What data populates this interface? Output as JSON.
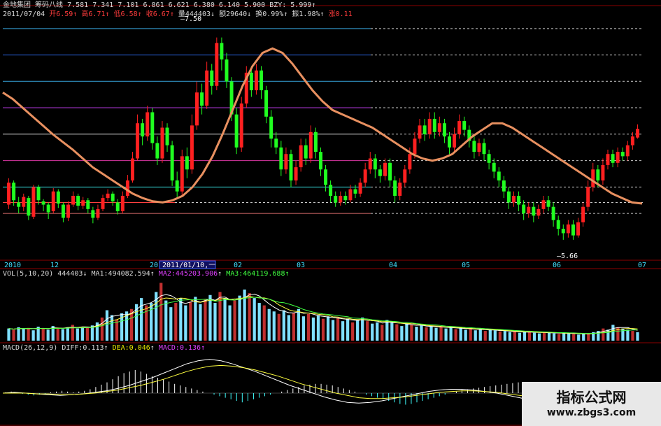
{
  "header": {
    "stock_name": "金地集团",
    "indicator_name": "筹码八线",
    "levels": [
      "7.581",
      "7.341",
      "7.101",
      "6.861",
      "6.621",
      "6.380",
      "6.140",
      "5.900"
    ],
    "bzy": "BZY: 5.999",
    "date": "2011/07/04",
    "open": "开6.59",
    "high": "高6.71",
    "low": "低6.58",
    "close": "收6.67",
    "volume": "量444403",
    "amount": "额29640",
    "turnover": "换0.99%",
    "amplitude": "振1.98%",
    "change": "涨0.11"
  },
  "price_annotations": {
    "high_label": "7.50",
    "low_label": "5.66",
    "cursor_date": "2011/01/10,一"
  },
  "x_axis": {
    "labels": [
      "2010",
      "12",
      "2011",
      "02",
      "03",
      "04",
      "05",
      "06",
      "07"
    ]
  },
  "volume_header": {
    "name": "VOL(5,10,20)",
    "value": "444403",
    "ma1": "MA1:494082.594",
    "ma2": "MA2:445203.906",
    "ma3": "MA3:464119.688"
  },
  "macd_header": {
    "name": "MACD(26,12,9)",
    "diff": "DIFF:0.113",
    "dea": "DEA:0.046",
    "macd": "MACD:0.136"
  },
  "watermark": {
    "line1": "指标公式网",
    "line2": "www.zbgs3.com"
  },
  "chart_data": {
    "type": "candlestick",
    "title": "",
    "price_range": [
      5.5,
      7.65
    ],
    "chip_lines": [
      7.581,
      7.341,
      7.101,
      6.861,
      6.621,
      6.38,
      6.14,
      5.9
    ],
    "bzy": 5.999,
    "candles": [
      [
        5.98,
        6.18,
        6.22,
        5.94
      ],
      [
        6.18,
        6.02,
        6.2,
        5.97
      ],
      [
        6.0,
        5.96,
        6.05,
        5.9
      ],
      [
        5.96,
        6.05,
        6.08,
        5.92
      ],
      [
        6.04,
        5.88,
        6.06,
        5.84
      ],
      [
        5.87,
        6.14,
        6.16,
        5.85
      ],
      [
        6.14,
        6.02,
        6.16,
        5.98
      ],
      [
        6.01,
        5.98,
        6.03,
        5.92
      ],
      [
        5.98,
        5.91,
        6.0,
        5.85
      ],
      [
        5.92,
        6.1,
        6.13,
        5.9
      ],
      [
        6.1,
        5.99,
        6.12,
        5.95
      ],
      [
        5.98,
        5.86,
        6.0,
        5.82
      ],
      [
        5.86,
        5.98,
        6.01,
        5.83
      ],
      [
        5.98,
        6.06,
        6.1,
        5.96
      ],
      [
        6.06,
        5.97,
        6.08,
        5.93
      ],
      [
        5.97,
        6.02,
        6.05,
        5.94
      ],
      [
        6.02,
        5.94,
        6.04,
        5.9
      ],
      [
        5.93,
        5.86,
        5.96,
        5.81
      ],
      [
        5.86,
        5.94,
        5.98,
        5.84
      ],
      [
        5.94,
        6.04,
        6.07,
        5.92
      ],
      [
        6.04,
        6.08,
        6.12,
        6.01
      ],
      [
        6.08,
        6.01,
        6.1,
        5.97
      ],
      [
        6.0,
        5.92,
        6.03,
        5.89
      ],
      [
        5.92,
        6.06,
        6.1,
        5.9
      ],
      [
        6.06,
        6.2,
        6.25,
        6.04
      ],
      [
        6.2,
        6.4,
        6.46,
        6.18
      ],
      [
        6.4,
        6.72,
        6.8,
        6.38
      ],
      [
        6.72,
        6.6,
        6.76,
        6.52
      ],
      [
        6.6,
        6.82,
        6.88,
        6.56
      ],
      [
        6.82,
        6.54,
        6.86,
        6.48
      ],
      [
        6.54,
        6.4,
        6.6,
        6.34
      ],
      [
        6.4,
        6.68,
        6.74,
        6.36
      ],
      [
        6.68,
        6.52,
        6.72,
        6.46
      ],
      [
        6.52,
        6.2,
        6.56,
        6.15
      ],
      [
        6.2,
        6.1,
        6.28,
        6.05
      ],
      [
        6.1,
        6.42,
        6.48,
        6.06
      ],
      [
        6.42,
        6.3,
        6.5,
        6.22
      ],
      [
        6.3,
        6.7,
        6.8,
        6.26
      ],
      [
        6.7,
        7.0,
        7.1,
        6.66
      ],
      [
        7.0,
        6.88,
        7.08,
        6.8
      ],
      [
        6.88,
        7.2,
        7.28,
        6.85
      ],
      [
        7.2,
        7.06,
        7.26,
        6.98
      ],
      [
        7.06,
        7.45,
        7.5,
        7.02
      ],
      [
        7.45,
        7.3,
        7.5,
        7.2
      ],
      [
        7.3,
        7.1,
        7.36,
        7.04
      ],
      [
        7.1,
        6.8,
        7.14,
        6.74
      ],
      [
        6.8,
        6.5,
        6.86,
        6.44
      ],
      [
        6.5,
        6.9,
        6.96,
        6.46
      ],
      [
        6.9,
        7.18,
        7.24,
        6.86
      ],
      [
        7.18,
        7.02,
        7.24,
        6.96
      ],
      [
        7.02,
        7.2,
        7.26,
        6.98
      ],
      [
        7.2,
        7.02,
        7.24,
        6.94
      ],
      [
        7.02,
        6.78,
        7.06,
        6.72
      ],
      [
        6.78,
        6.58,
        6.84,
        6.5
      ],
      [
        6.58,
        6.5,
        6.64,
        6.44
      ],
      [
        6.5,
        6.3,
        6.56,
        6.24
      ],
      [
        6.3,
        6.44,
        6.5,
        6.26
      ],
      [
        6.44,
        6.2,
        6.48,
        6.14
      ],
      [
        6.2,
        6.32,
        6.38,
        6.16
      ],
      [
        6.32,
        6.52,
        6.58,
        6.28
      ],
      [
        6.52,
        6.4,
        6.58,
        6.34
      ],
      [
        6.4,
        6.64,
        6.7,
        6.36
      ],
      [
        6.64,
        6.46,
        6.68,
        6.4
      ],
      [
        6.46,
        6.3,
        6.5,
        6.24
      ],
      [
        6.3,
        6.16,
        6.34,
        6.1
      ],
      [
        6.16,
        6.06,
        6.2,
        6.0
      ],
      [
        6.06,
        6.0,
        6.1,
        5.96
      ],
      [
        6.0,
        6.06,
        6.1,
        5.97
      ],
      [
        6.06,
        6.02,
        6.1,
        5.98
      ],
      [
        6.02,
        6.12,
        6.16,
        6.0
      ],
      [
        6.12,
        6.08,
        6.16,
        6.04
      ],
      [
        6.08,
        6.18,
        6.22,
        6.05
      ],
      [
        6.18,
        6.3,
        6.36,
        6.14
      ],
      [
        6.3,
        6.4,
        6.46,
        6.26
      ],
      [
        6.4,
        6.3,
        6.44,
        6.22
      ],
      [
        6.3,
        6.24,
        6.34,
        6.18
      ],
      [
        6.24,
        6.36,
        6.4,
        6.2
      ],
      [
        6.36,
        6.2,
        6.4,
        6.14
      ],
      [
        6.2,
        6.06,
        6.24,
        6.0
      ],
      [
        6.06,
        6.18,
        6.22,
        6.02
      ],
      [
        6.18,
        6.3,
        6.34,
        6.14
      ],
      [
        6.3,
        6.44,
        6.5,
        6.26
      ],
      [
        6.44,
        6.58,
        6.64,
        6.4
      ],
      [
        6.58,
        6.7,
        6.76,
        6.54
      ],
      [
        6.7,
        6.62,
        6.76,
        6.56
      ],
      [
        6.62,
        6.76,
        6.82,
        6.58
      ],
      [
        6.76,
        6.64,
        6.82,
        6.58
      ],
      [
        6.64,
        6.72,
        6.78,
        6.6
      ],
      [
        6.72,
        6.6,
        6.76,
        6.54
      ],
      [
        6.6,
        6.5,
        6.64,
        6.44
      ],
      [
        6.5,
        6.62,
        6.68,
        6.46
      ],
      [
        6.62,
        6.74,
        6.8,
        6.58
      ],
      [
        6.74,
        6.66,
        6.78,
        6.6
      ],
      [
        6.66,
        6.56,
        6.7,
        6.5
      ],
      [
        6.56,
        6.46,
        6.6,
        6.4
      ],
      [
        6.46,
        6.54,
        6.58,
        6.42
      ],
      [
        6.54,
        6.44,
        6.58,
        6.38
      ],
      [
        6.44,
        6.36,
        6.48,
        6.3
      ],
      [
        6.36,
        6.28,
        6.4,
        6.22
      ],
      [
        6.28,
        6.2,
        6.32,
        6.14
      ],
      [
        6.2,
        6.1,
        6.24,
        6.04
      ],
      [
        6.1,
        6.0,
        6.14,
        5.94
      ],
      [
        6.0,
        6.06,
        6.1,
        5.96
      ],
      [
        6.06,
        5.98,
        6.1,
        5.92
      ],
      [
        5.98,
        5.9,
        6.02,
        5.84
      ],
      [
        5.9,
        5.96,
        6.0,
        5.86
      ],
      [
        5.96,
        5.88,
        6.0,
        5.82
      ],
      [
        5.88,
        5.94,
        5.98,
        5.85
      ],
      [
        5.94,
        6.02,
        6.06,
        5.9
      ],
      [
        6.02,
        5.96,
        6.06,
        5.92
      ],
      [
        5.96,
        5.84,
        6.0,
        5.78
      ],
      [
        5.84,
        5.76,
        5.88,
        5.7
      ],
      [
        5.76,
        5.72,
        5.8,
        5.66
      ],
      [
        5.72,
        5.8,
        5.84,
        5.68
      ],
      [
        5.8,
        5.7,
        5.84,
        5.66
      ],
      [
        5.7,
        5.82,
        5.86,
        5.68
      ],
      [
        5.82,
        5.96,
        6.0,
        5.78
      ],
      [
        5.96,
        6.14,
        6.2,
        5.92
      ],
      [
        6.14,
        6.3,
        6.36,
        6.1
      ],
      [
        6.3,
        6.2,
        6.34,
        6.14
      ],
      [
        6.2,
        6.34,
        6.4,
        6.16
      ],
      [
        6.34,
        6.44,
        6.48,
        6.3
      ],
      [
        6.44,
        6.36,
        6.48,
        6.32
      ],
      [
        6.36,
        6.46,
        6.5,
        6.32
      ],
      [
        6.46,
        6.42,
        6.5,
        6.38
      ],
      [
        6.42,
        6.52,
        6.56,
        6.38
      ],
      [
        6.52,
        6.6,
        6.64,
        6.48
      ],
      [
        6.59,
        6.67,
        6.71,
        6.58
      ]
    ],
    "ma_line": [
      7.0,
      6.94,
      6.86,
      6.78,
      6.7,
      6.62,
      6.55,
      6.48,
      6.4,
      6.32,
      6.26,
      6.2,
      6.14,
      6.08,
      6.04,
      6.01,
      6.0,
      6.02,
      6.06,
      6.14,
      6.26,
      6.42,
      6.62,
      6.84,
      7.06,
      7.24,
      7.36,
      7.4,
      7.36,
      7.26,
      7.14,
      7.02,
      6.92,
      6.84,
      6.8,
      6.76,
      6.72,
      6.68,
      6.62,
      6.56,
      6.5,
      6.44,
      6.4,
      6.38,
      6.4,
      6.44,
      6.52,
      6.6,
      6.66,
      6.72,
      6.72,
      6.68,
      6.62,
      6.56,
      6.5,
      6.44,
      6.38,
      6.32,
      6.26,
      6.2,
      6.14,
      6.08,
      6.04,
      6.0,
      5.99
    ],
    "volume": {
      "ma_labels": [
        "MA1",
        "MA2",
        "MA3"
      ],
      "bars": [
        0.2,
        0.18,
        0.22,
        0.19,
        0.21,
        0.17,
        0.23,
        0.2,
        0.18,
        0.24,
        0.21,
        0.19,
        0.22,
        0.26,
        0.2,
        0.23,
        0.21,
        0.25,
        0.3,
        0.38,
        0.5,
        0.42,
        0.35,
        0.45,
        0.48,
        0.52,
        0.6,
        0.7,
        0.58,
        0.62,
        0.8,
        0.95,
        0.66,
        0.55,
        0.62,
        0.7,
        0.58,
        0.64,
        0.72,
        0.6,
        0.68,
        0.75,
        0.62,
        0.8,
        0.7,
        0.58,
        0.66,
        0.74,
        0.84,
        0.78,
        0.7,
        0.62,
        0.58,
        0.52,
        0.48,
        0.44,
        0.5,
        0.42,
        0.46,
        0.52,
        0.4,
        0.44,
        0.38,
        0.42,
        0.36,
        0.4,
        0.34,
        0.38,
        0.32,
        0.36,
        0.3,
        0.34,
        0.38,
        0.32,
        0.28,
        0.3,
        0.26,
        0.34,
        0.3,
        0.27,
        0.24,
        0.28,
        0.26,
        0.23,
        0.25,
        0.22,
        0.24,
        0.21,
        0.23,
        0.2,
        0.22,
        0.19,
        0.21,
        0.18,
        0.2,
        0.17,
        0.19,
        0.16,
        0.18,
        0.17,
        0.15,
        0.16,
        0.14,
        0.15,
        0.13,
        0.14,
        0.15,
        0.13,
        0.12,
        0.14,
        0.13,
        0.12,
        0.11,
        0.13,
        0.12,
        0.11,
        0.1,
        0.12,
        0.11,
        0.14,
        0.16,
        0.2,
        0.18,
        0.26,
        0.22,
        0.2,
        0.18,
        0.16,
        0.14
      ]
    },
    "macd": {
      "histogram": [
        0.01,
        0.02,
        0.01,
        -0.01,
        -0.02,
        -0.03,
        -0.02,
        -0.01,
        0.01,
        0.02,
        0.03,
        0.02,
        0.01,
        0.02,
        0.03,
        0.05,
        0.08,
        0.11,
        0.14,
        0.18,
        0.22,
        0.26,
        0.28,
        0.3,
        0.28,
        0.25,
        0.22,
        0.2,
        0.18,
        0.15,
        0.12,
        0.1,
        0.08,
        0.06,
        0.04,
        0.02,
        0.0,
        -0.02,
        -0.04,
        -0.06,
        -0.08,
        -0.1,
        -0.12,
        -0.1,
        -0.08,
        -0.06,
        -0.04,
        -0.02,
        0.0,
        0.02,
        0.04,
        0.06,
        0.08,
        0.1,
        0.11,
        0.12,
        0.12,
        0.11,
        0.1,
        0.08,
        0.06,
        0.04,
        0.02,
        0.0,
        -0.02,
        -0.04,
        -0.06,
        -0.08,
        -0.1,
        -0.12,
        -0.14,
        -0.15,
        -0.14,
        -0.12,
        -0.1,
        -0.08,
        -0.06,
        -0.04,
        -0.02,
        0.0,
        0.02,
        0.04,
        0.05,
        0.06,
        0.07,
        0.08,
        0.09,
        0.1,
        0.11,
        0.12,
        0.13,
        0.14
      ],
      "diff_line": [
        0.0,
        0.01,
        0.0,
        -0.01,
        -0.02,
        -0.03,
        -0.02,
        -0.01,
        0.01,
        0.03,
        0.06,
        0.1,
        0.15,
        0.2,
        0.26,
        0.32,
        0.38,
        0.42,
        0.44,
        0.42,
        0.38,
        0.33,
        0.28,
        0.22,
        0.16,
        0.1,
        0.05,
        0.0,
        -0.05,
        -0.09,
        -0.12,
        -0.13,
        -0.12,
        -0.1,
        -0.07,
        -0.04,
        -0.01,
        0.02,
        0.04,
        0.05,
        0.05,
        0.04,
        0.02,
        0.0,
        -0.03,
        -0.06,
        -0.09,
        -0.12,
        -0.15,
        -0.17,
        -0.18,
        -0.16,
        -0.13,
        -0.08,
        -0.02,
        0.04,
        0.08,
        0.11
      ],
      "dea_line": [
        0.0,
        0.0,
        0.0,
        -0.01,
        -0.01,
        -0.02,
        -0.02,
        -0.01,
        0.0,
        0.02,
        0.04,
        0.07,
        0.1,
        0.14,
        0.18,
        0.23,
        0.28,
        0.32,
        0.35,
        0.36,
        0.35,
        0.33,
        0.3,
        0.26,
        0.22,
        0.17,
        0.12,
        0.08,
        0.04,
        0.0,
        -0.03,
        -0.06,
        -0.07,
        -0.07,
        -0.06,
        -0.05,
        -0.03,
        -0.01,
        0.01,
        0.02,
        0.03,
        0.03,
        0.02,
        0.01,
        -0.01,
        -0.03,
        -0.05,
        -0.07,
        -0.09,
        -0.11,
        -0.13,
        -0.13,
        -0.12,
        -0.1,
        -0.07,
        -0.04,
        0.0,
        0.05
      ]
    }
  }
}
